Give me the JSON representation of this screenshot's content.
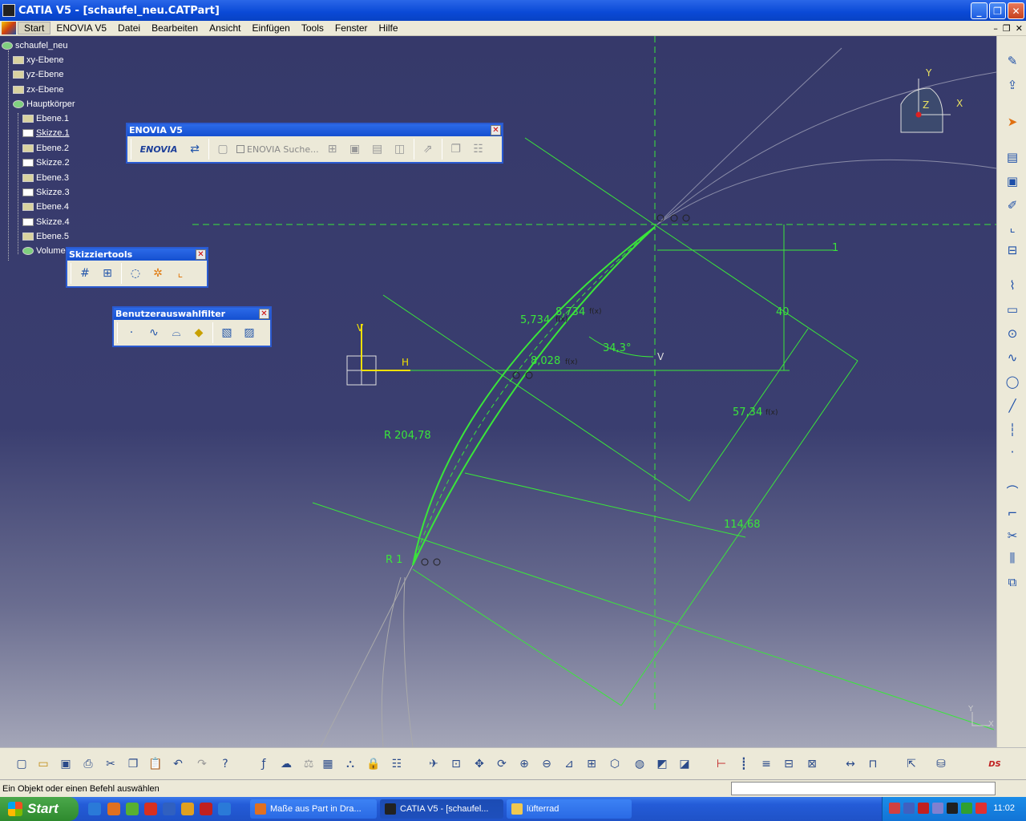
{
  "window": {
    "title": "CATIA V5 - [schaufel_neu.CATPart]"
  },
  "menu": {
    "items": [
      "Start",
      "ENOVIA V5",
      "Datei",
      "Bearbeiten",
      "Ansicht",
      "Einfügen",
      "Tools",
      "Fenster",
      "Hilfe"
    ],
    "active": "Start"
  },
  "tree": {
    "root": "schaufel_neu",
    "items": [
      "xy-Ebene",
      "yz-Ebene",
      "zx-Ebene",
      "Hauptkörper",
      "Ebene.1",
      "Skizze.1",
      "Ebene.2",
      "Skizze.2",
      "Ebene.3",
      "Skizze.3",
      "Ebene.4",
      "Skizze.4",
      "Ebene.5",
      "Volumen"
    ]
  },
  "toolbars": {
    "enovia": {
      "title": "ENOVIA V5",
      "search_label": "ENOVIA Suche..."
    },
    "sketch_tools": {
      "title": "Skizziertools"
    },
    "selection_filter": {
      "title": "Benutzerauswahlfilter"
    }
  },
  "sketch": {
    "dimensions": [
      "1",
      "40",
      "34,3°",
      "8,734",
      "5,734",
      "8,028",
      "57,34",
      "114,68",
      "R 204,78",
      "R 1"
    ],
    "axis_labels": {
      "h": "H",
      "v": "V",
      "v_small": "V"
    },
    "compass": {
      "x": "X",
      "y": "Y",
      "z": "Z"
    },
    "corner_axis": {
      "y": "Y",
      "x": "X"
    },
    "formula_marker": "f(x)",
    "colors": {
      "geometry": "#3ae63a",
      "background": "#36396a"
    }
  },
  "status": {
    "message": "Ein Objekt oder einen Befehl auswählen"
  },
  "taskbar": {
    "start_label": "Start",
    "buttons": [
      {
        "label": "Maße aus Part in Dra...",
        "active": false
      },
      {
        "label": "CATIA V5 - [schaufel...",
        "active": true
      },
      {
        "label": "lüfterrad",
        "active": false
      }
    ],
    "clock": "11:02"
  }
}
